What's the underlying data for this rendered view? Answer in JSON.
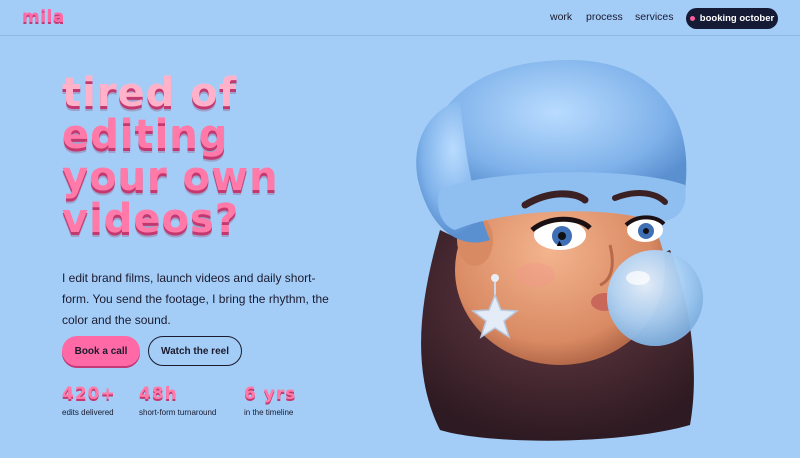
{
  "brand": {
    "logo": "mila"
  },
  "nav": {
    "work": "work",
    "process": "process",
    "services": "services",
    "cta": "booking october"
  },
  "hero": {
    "headline": [
      "tired of",
      "editing",
      "your own",
      "videos?"
    ],
    "lede": "I edit brand films, launch videos and daily short-form. You send the footage, I bring the rhythm, the color and the sound.",
    "primary_cta": "Book a call",
    "secondary_cta": "Watch the reel"
  },
  "stats": [
    {
      "value": "420+",
      "label": "edits delivered"
    },
    {
      "value": "48h",
      "label": "short-form turnaround"
    },
    {
      "value": "6 yrs",
      "label": "in the timeline"
    }
  ],
  "colors": {
    "background": "#a3cdf7",
    "accent": "#ff6aa6",
    "dark": "#151a35"
  },
  "icons": {
    "booking_status": "status-dot-icon",
    "pointer": "mouse-cursor-icon"
  }
}
